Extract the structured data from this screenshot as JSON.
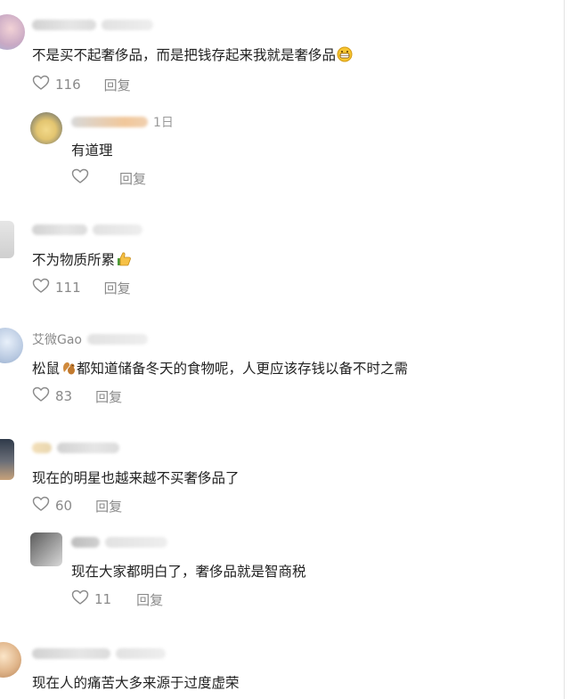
{
  "comments": [
    {
      "meta_text": "",
      "text": "不是买不起奢侈品，而是把钱存起来我就是奢侈品",
      "emoji": "grin-emoji",
      "likes": "116",
      "reply_label": "回复"
    },
    {
      "meta_text": "1日",
      "text": "有道理",
      "likes": "",
      "reply_label": "回复"
    },
    {
      "meta_text": "",
      "text": "不为物质所累",
      "emoji": "thumbs-up-emoji",
      "likes": "111",
      "reply_label": "回复"
    },
    {
      "meta_text": "艾微Gao",
      "text_before": "松鼠",
      "emoji": "squirrel-emoji",
      "text_after": "都知道储备冬天的食物呢，人更应该存钱以备不时之需",
      "likes": "83",
      "reply_label": "回复"
    },
    {
      "meta_text": "",
      "text": "现在的明星也越来越不买奢侈品了",
      "likes": "60",
      "reply_label": "回复"
    },
    {
      "meta_text": "",
      "text": "现在大家都明白了，奢侈品就是智商税",
      "likes": "11",
      "reply_label": "回复"
    },
    {
      "meta_text": "",
      "text": "现在人的痛苦大多来源于过度虚荣"
    }
  ],
  "colors": {
    "text": "#222222",
    "muted": "#8a8a8a",
    "background": "#ffffff"
  }
}
